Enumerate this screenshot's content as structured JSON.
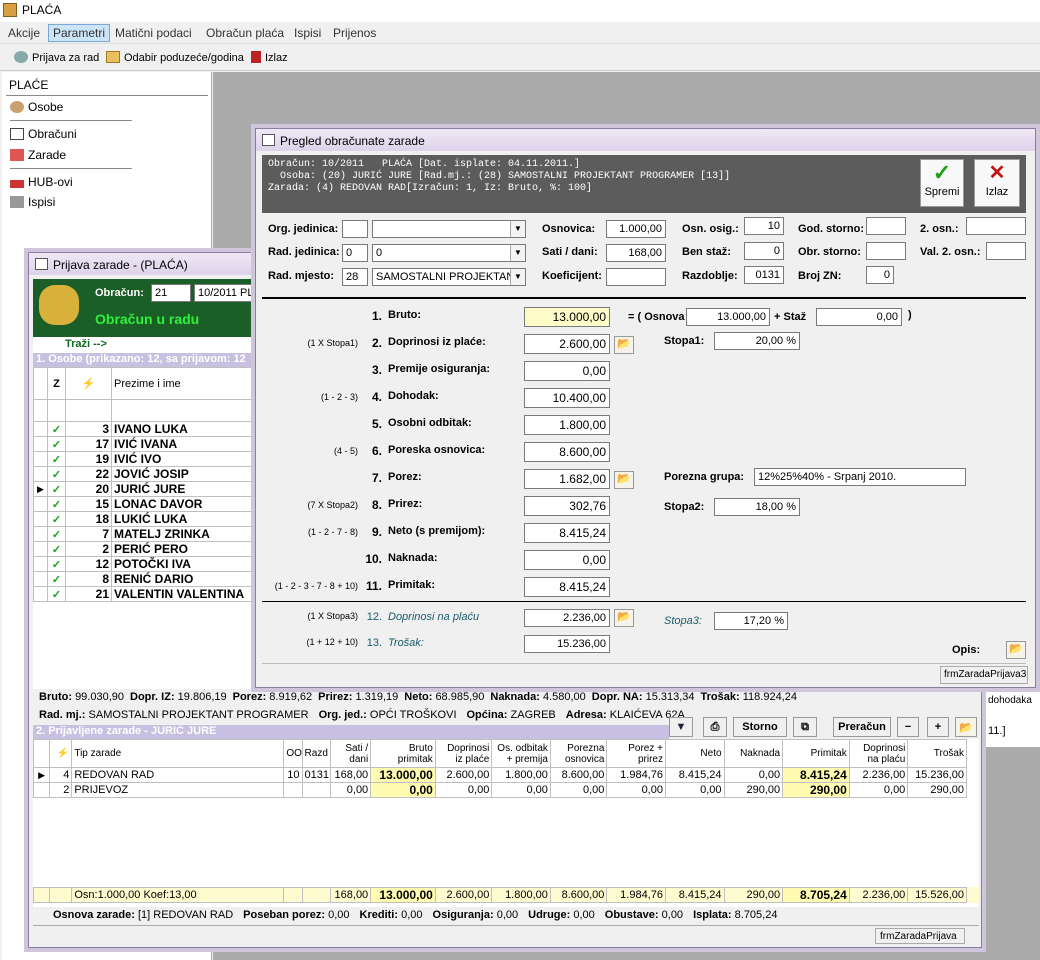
{
  "app": {
    "title": "PLAĆA"
  },
  "menu": [
    "Akcije",
    "Parametri",
    "Matični podaci",
    "Obračun plaća",
    "Ispisi",
    "Prijenos"
  ],
  "toolbar": {
    "prijava": "Prijava za rad",
    "odabir": "Odabir poduzeće/godina",
    "izlaz": "Izlaz"
  },
  "left": {
    "header": "PLAĆE",
    "items": [
      "Osobe",
      "Obračuni",
      "Zarade",
      "HUB-ovi",
      "Ispisi"
    ]
  },
  "prijava": {
    "title": "Prijava zarade - (PLAĆA)",
    "obracun_label": "Obračun:",
    "obracun_value": "21",
    "obracun_desc": "10/2011  PL",
    "status": "Obračun u radu",
    "trazi": "Traži -->",
    "osobe_header": "1. Osobe (prikazano: 12, sa prijavom: 12",
    "osobe_cols": [
      "Z",
      "⚡",
      "Prezime i ime"
    ],
    "osobe": [
      {
        "n": "3",
        "name": "IVANO LUKA"
      },
      {
        "n": "17",
        "name": "IVIĆ IVANA"
      },
      {
        "n": "19",
        "name": "IVIĆ IVO"
      },
      {
        "n": "22",
        "name": "JOVIĆ JOSIP"
      },
      {
        "n": "20",
        "name": "JURIĆ JURE"
      },
      {
        "n": "15",
        "name": "LONAC DAVOR"
      },
      {
        "n": "18",
        "name": "LUKIĆ LUKA"
      },
      {
        "n": "7",
        "name": "MATELJ ZRINKA"
      },
      {
        "n": "2",
        "name": "PERIĆ PERO"
      },
      {
        "n": "12",
        "name": "POTOČKI IVA"
      },
      {
        "n": "8",
        "name": "RENIĆ DARIO"
      },
      {
        "n": "21",
        "name": "VALENTIN VALENTINA"
      }
    ],
    "totals": [
      {
        "k": "Bruto:",
        "v": "99.030,90"
      },
      {
        "k": "Dopr. IZ:",
        "v": "19.806,19"
      },
      {
        "k": "Porez:",
        "v": "8.919,62"
      },
      {
        "k": "Prirez:",
        "v": "1.319,19"
      },
      {
        "k": "Neto:",
        "v": "68.985,90"
      },
      {
        "k": "Naknada:",
        "v": "4.580,00"
      },
      {
        "k": "Dopr. NA:",
        "v": "15.313,34"
      },
      {
        "k": "Trošak:",
        "v": "118.924,24"
      }
    ],
    "info": [
      {
        "k": "Rad. mj.:",
        "v": "SAMOSTALNI PROJEKTANT PROGRAMER"
      },
      {
        "k": "Org. jed.:",
        "v": "OPĆI TROŠKOVI"
      },
      {
        "k": "Općina:",
        "v": "ZAGREB"
      },
      {
        "k": "Adresa:",
        "v": "KLAIĆEVA 62A"
      }
    ],
    "prijavljene_header": "2. Prijavljene zarade - JURIĆ JURE",
    "btn_storno": "Storno",
    "btn_preracun": "Preračun",
    "z_cols": [
      "⚡",
      "Tip zarade",
      "OO",
      "Razd",
      "Sati / dani",
      "Bruto primitak",
      "Doprinosi iz plaće",
      "Os. odbitak + premija",
      "Porezna osnovica",
      "Porez + prirez",
      "Neto",
      "Naknada",
      "Primitak",
      "Doprinosi na plaću",
      "Trošak"
    ],
    "z_rows": [
      [
        "4",
        "REDOVAN RAD",
        "10",
        "0131",
        "168,00",
        "13.000,00",
        "2.600,00",
        "1.800,00",
        "8.600,00",
        "1.984,76",
        "8.415,24",
        "0,00",
        "8.415,24",
        "2.236,00",
        "15.236,00"
      ],
      [
        "2",
        "PRIJEVOZ",
        "",
        "",
        "0,00",
        "0,00",
        "0,00",
        "0,00",
        "0,00",
        "0,00",
        "0,00",
        "290,00",
        "290,00",
        "0,00",
        "290,00"
      ]
    ],
    "z_total": [
      "Osn:1.000,00  Koef:13,00",
      "",
      "",
      "168,00",
      "13.000,00",
      "2.600,00",
      "1.800,00",
      "8.600,00",
      "1.984,76",
      "8.415,24",
      "290,00",
      "8.705,24",
      "2.236,00",
      "15.526,00"
    ],
    "footer": [
      {
        "k": "Osnova zarade:",
        "v": "[1] REDOVAN RAD"
      },
      {
        "k": "Poseban porez:",
        "v": "0,00"
      },
      {
        "k": "Krediti:",
        "v": "0,00"
      },
      {
        "k": "Osiguranja:",
        "v": "0,00"
      },
      {
        "k": "Udruge:",
        "v": "0,00"
      },
      {
        "k": "Obustave:",
        "v": "0,00"
      },
      {
        "k": "Isplata:",
        "v": "8.705,24"
      }
    ],
    "status_name": "frmZaradaPrijava"
  },
  "pregled": {
    "title": "Pregled obračunate zarade",
    "header_lines": [
      "Obračun: 10/2011   PLAĆA [Dat. isplate: 04.11.2011.]",
      "  Osoba: (20) JURIĆ JURE [Rad.mj.: (28) SAMOSTALNI PROJEKTANT PROGRAMER [13]]",
      "",
      "Zarada: (4) REDOVAN RAD[Izračun: 1, Iz: Bruto, %: 100]"
    ],
    "btn_spremi": "Spremi",
    "btn_izlaz": "Izlaz",
    "fields": {
      "org_jed_label": "Org. jedinica:",
      "org_jed": "",
      "org_jed_name": "",
      "rad_jed_label": "Rad. jedinica:",
      "rad_jed": "0",
      "rad_jed_name": "0",
      "rad_mj_label": "Rad. mjesto:",
      "rad_mj": "28",
      "rad_mj_name": "SAMOSTALNI PROJEKTAN",
      "osnovica_label": "Osnovica:",
      "osnovica": "1.000,00",
      "sati_label": "Sati / dani:",
      "sati": "168,00",
      "koef_label": "Koeficijent:",
      "koef": "",
      "osn_osig_label": "Osn. osig.:",
      "osn_osig": "10",
      "ben_staz_label": "Ben staž:",
      "ben_staz": "0",
      "razdoblje_label": "Razdoblje:",
      "razdoblje": "0131",
      "god_storno_label": "God. storno:",
      "god_storno": "",
      "obr_storno_label": "Obr. storno:",
      "obr_storno": "",
      "broj_zn_label": "Broj ZN:",
      "broj_zn": "0",
      "osn2_label": "2. osn.:",
      "osn2": "",
      "val2_label": "Val. 2. osn.:",
      "val2": ""
    },
    "calc": [
      {
        "f": "",
        "n": "1.",
        "l": "Bruto:",
        "v": "13.000,00"
      },
      {
        "f": "(1 X Stopa1)",
        "n": "2.",
        "l": "Doprinosi iz plaće:",
        "v": "2.600,00"
      },
      {
        "f": "",
        "n": "3.",
        "l": "Premije osiguranja:",
        "v": "0,00"
      },
      {
        "f": "(1 - 2 - 3)",
        "n": "4.",
        "l": "Dohodak:",
        "v": "10.400,00"
      },
      {
        "f": "",
        "n": "5.",
        "l": "Osobni odbitak:",
        "v": "1.800,00"
      },
      {
        "f": "(4 - 5)",
        "n": "6.",
        "l": "Poreska osnovica:",
        "v": "8.600,00"
      },
      {
        "f": "",
        "n": "7.",
        "l": "Porez:",
        "v": "1.682,00"
      },
      {
        "f": "(7 X Stopa2)",
        "n": "8.",
        "l": "Prirez:",
        "v": "302,76"
      },
      {
        "f": "(1 - 2 - 7 - 8)",
        "n": "9.",
        "l": "Neto (s premijom):",
        "v": "8.415,24"
      },
      {
        "f": "",
        "n": "10.",
        "l": "Naknada:",
        "v": "0,00"
      },
      {
        "f": "(1 - 2 - 3 - 7 - 8 + 10)",
        "n": "11.",
        "l": "Primitak:",
        "v": "8.415,24"
      }
    ],
    "calc2": [
      {
        "f": "(1 X Stopa3)",
        "n": "12.",
        "l": "Doprinosi na plaću",
        "v": "2.236,00"
      },
      {
        "f": "(1 + 12 + 10)",
        "n": "13.",
        "l": "Trošak:",
        "v": "15.236,00"
      }
    ],
    "osnova_label": "= ( Osnova",
    "osnova": "13.000,00",
    "staz_label": "+ Staž",
    "staz": "0,00",
    "close_paren": ")",
    "stopa1_label": "Stopa1:",
    "stopa1": "20,00 %",
    "porezna_grupa_label": "Porezna grupa:",
    "porezna_grupa": "12%25%40% - Srpanj 2010.",
    "stopa2_label": "Stopa2:",
    "stopa2": "18,00 %",
    "stopa3_label": "Stopa3:",
    "stopa3": "17,20 %",
    "opis_label": "Opis:",
    "status_name": "frmZaradaPrijava3"
  },
  "bg_text": {
    "a": "dohodaka",
    "b": "11.]"
  }
}
